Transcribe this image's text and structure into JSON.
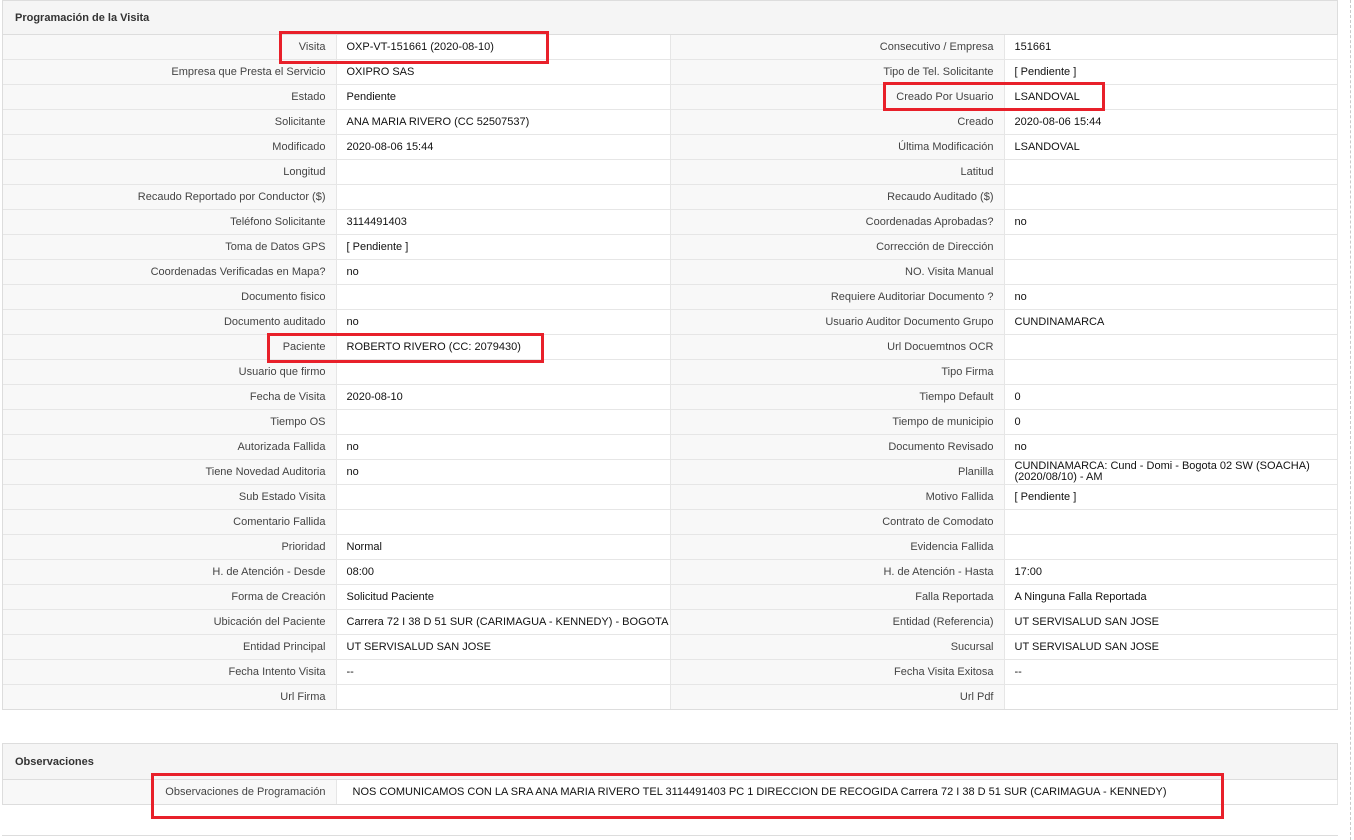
{
  "programacion": {
    "title": "Programación de la Visita",
    "rows": [
      [
        {
          "label": "Visita",
          "value": "OXP-VT-151661 (2020-08-10)"
        },
        {
          "label": "Consecutivo / Empresa",
          "value": "151661"
        }
      ],
      [
        {
          "label": "Empresa que Presta el Servicio",
          "value": "OXIPRO SAS"
        },
        {
          "label": "Tipo de Tel. Solicitante",
          "value": "[ Pendiente ]"
        }
      ],
      [
        {
          "label": "Estado",
          "value": "Pendiente"
        },
        {
          "label": "Creado Por Usuario",
          "value": "LSANDOVAL"
        }
      ],
      [
        {
          "label": "Solicitante",
          "value": "ANA MARIA RIVERO (CC 52507537)"
        },
        {
          "label": "Creado",
          "value": "2020-08-06 15:44"
        }
      ],
      [
        {
          "label": "Modificado",
          "value": "2020-08-06 15:44"
        },
        {
          "label": "Última Modificación",
          "value": " LSANDOVAL"
        }
      ],
      [
        {
          "label": "Longitud",
          "value": ""
        },
        {
          "label": "Latitud",
          "value": ""
        }
      ],
      [
        {
          "label": "Recaudo Reportado por Conductor ($)",
          "value": ""
        },
        {
          "label": "Recaudo Auditado ($)",
          "value": ""
        }
      ],
      [
        {
          "label": "Teléfono Solicitante",
          "value": "3114491403"
        },
        {
          "label": "Coordenadas Aprobadas?",
          "value": " no"
        }
      ],
      [
        {
          "label": "Toma de Datos GPS",
          "value": "[ Pendiente ]"
        },
        {
          "label": "Corrección de Dirección",
          "value": ""
        }
      ],
      [
        {
          "label": "Coordenadas Verificadas en Mapa?",
          "value": " no"
        },
        {
          "label": "NO. Visita Manual",
          "value": ""
        }
      ],
      [
        {
          "label": "Documento fisico",
          "value": ""
        },
        {
          "label": "Requiere Auditoriar Documento ?",
          "value": " no"
        }
      ],
      [
        {
          "label": "Documento auditado",
          "value": " no"
        },
        {
          "label": "Usuario Auditor Documento Grupo",
          "value": "CUNDINAMARCA"
        }
      ],
      [
        {
          "label": "Paciente",
          "value": "ROBERTO RIVERO (CC: 2079430)"
        },
        {
          "label": "Url Docuemtnos OCR",
          "value": ""
        }
      ],
      [
        {
          "label": "Usuario que firmo",
          "value": ""
        },
        {
          "label": "Tipo Firma",
          "value": ""
        }
      ],
      [
        {
          "label": "Fecha de Visita",
          "value": " 2020-08-10"
        },
        {
          "label": "Tiempo Default",
          "value": "0"
        }
      ],
      [
        {
          "label": "Tiempo OS",
          "value": ""
        },
        {
          "label": "Tiempo de municipio",
          "value": "0"
        }
      ],
      [
        {
          "label": "Autorizada Fallida",
          "value": " no"
        },
        {
          "label": "Documento Revisado",
          "value": " no"
        }
      ],
      [
        {
          "label": "Tiene Novedad Auditoria",
          "value": " no"
        },
        {
          "label": "Planilla",
          "value": "CUNDINAMARCA: Cund - Domi - Bogota 02 SW (SOACHA) (2020/08/10) - AM"
        }
      ],
      [
        {
          "label": "Sub Estado Visita",
          "value": ""
        },
        {
          "label": "Motivo Fallida",
          "value": "[ Pendiente ]"
        }
      ],
      [
        {
          "label": "Comentario Fallida",
          "value": ""
        },
        {
          "label": "Contrato de Comodato",
          "value": ""
        }
      ],
      [
        {
          "label": "Prioridad",
          "value": "Normal"
        },
        {
          "label": "Evidencia Fallida",
          "value": ""
        }
      ],
      [
        {
          "label": "H. de Atención - Desde",
          "value": "08:00"
        },
        {
          "label": "H. de Atención - Hasta",
          "value": "17:00"
        }
      ],
      [
        {
          "label": "Forma de Creación",
          "value": "Solicitud Paciente"
        },
        {
          "label": "Falla Reportada",
          "value": "A Ninguna Falla Reportada"
        }
      ],
      [
        {
          "label": "Ubicación del Paciente",
          "value": "Carrera 72 I 38 D 51 SUR (CARIMAGUA - KENNEDY) - BOGOTA"
        },
        {
          "label": "Entidad (Referencia)",
          "value": "UT SERVISALUD SAN JOSE"
        }
      ],
      [
        {
          "label": "Entidad Principal",
          "value": "UT SERVISALUD SAN JOSE"
        },
        {
          "label": "Sucursal",
          "value": "UT SERVISALUD SAN JOSE"
        }
      ],
      [
        {
          "label": "Fecha Intento Visita",
          "value": " --"
        },
        {
          "label": "Fecha Visita Exitosa",
          "value": " --"
        }
      ],
      [
        {
          "label": "Url Firma",
          "value": ""
        },
        {
          "label": "Url Pdf",
          "value": ""
        }
      ]
    ]
  },
  "observaciones": {
    "title": "Observaciones",
    "label": "Observaciones de Programación",
    "value": "NOS COMUNICAMOS CON LA SRA ANA MARIA RIVERO TEL 3114491403 PC 1 DIRECCION DE RECOGIDA Carrera 72 I 38 D 51 SUR (CARIMAGUA - KENNEDY)"
  },
  "highlight_color": "#e8202a"
}
